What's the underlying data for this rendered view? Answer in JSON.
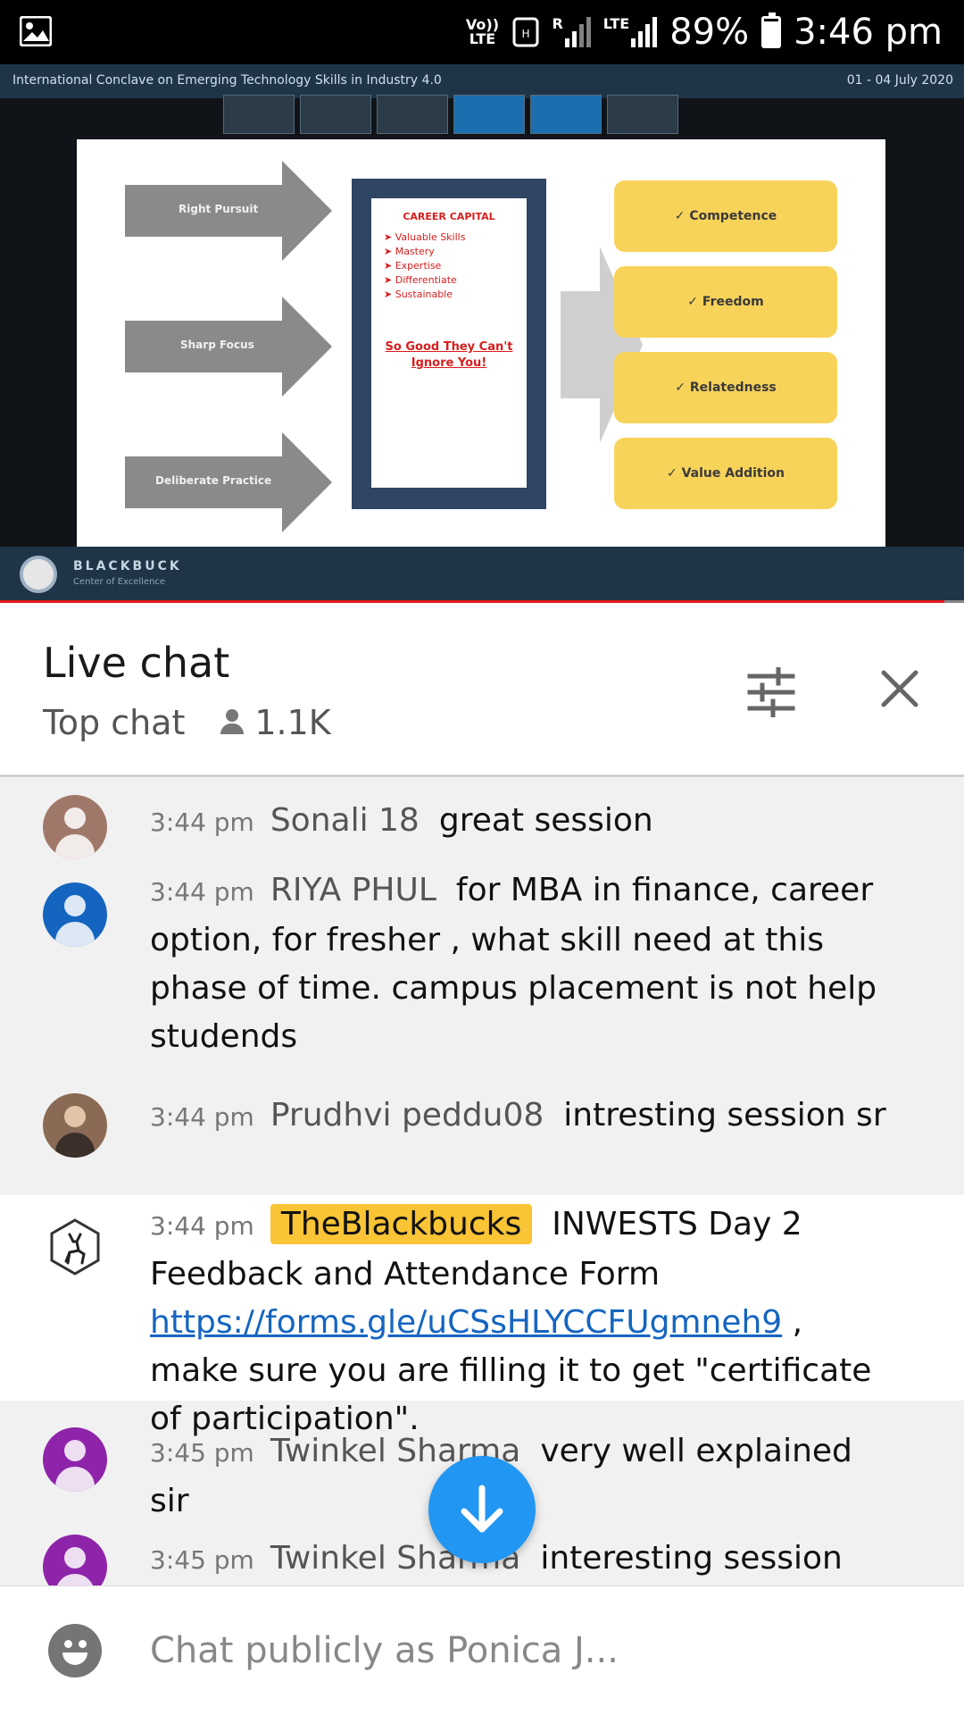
{
  "status_bar": {
    "volte": "Vo)) LTE",
    "roaming": "R",
    "network": "LTE",
    "battery": "89%",
    "battery_level": 0.89,
    "time": "3:46 pm"
  },
  "video": {
    "banner_title": "International Conclave on Emerging Technology Skills in Industry 4.0",
    "banner_date": "01 - 04 July 2020",
    "slide": {
      "arrows": [
        "Right Pursuit",
        "Sharp Focus",
        "Deliberate Practice"
      ],
      "career_capital_title": "CAREER CAPITAL",
      "career_capital_items": [
        "Valuable Skills",
        "Mastery",
        "Expertise",
        "Differentiate",
        "Sustainable"
      ],
      "quote": "So Good They Can't Ignore You!",
      "outcomes": [
        "✓ Competence",
        "✓ Freedom",
        "✓ Relatedness",
        "✓ Value Addition"
      ]
    },
    "footer_brand": "BLACKBUCK",
    "footer_brand_sub": "Center of Excellence",
    "progress": 0.98
  },
  "chat_header": {
    "title": "Live chat",
    "mode": "Top chat",
    "viewers": "1.1K"
  },
  "messages": [
    {
      "time": "3:44 pm",
      "author": "Sonali 18",
      "text": "great session",
      "avatar_color": "#a0786a"
    },
    {
      "time": "3:44 pm",
      "author": "RIYA PHUL",
      "text": "for MBA in finance, career option, for fresher , what skill need at this phase of time. campus placement is not help studends",
      "avatar_color": "#1565c0"
    },
    {
      "time": "3:44 pm",
      "author": "Prudhvi peddu08",
      "text": "intresting session sr",
      "avatar_color": "#8a6a55"
    },
    {
      "time": "3:44 pm",
      "author": "TheBlackbucks",
      "text_before": "INWESTS Day 2 Feedback and Attendance Form",
      "link": "https://forms.gle/uCSsHLYCCFUgmneh9",
      "text_after": ", make sure you are filling it to get \"certificate of participation\".",
      "avatar_color": "#ffffff"
    },
    {
      "time": "3:45 pm",
      "author": "Twinkel Sharma",
      "text": "very well explained sir",
      "avatar_color": "#8e24aa"
    },
    {
      "time": "3:45 pm",
      "author": "Twinkel Sharma",
      "text": "interesting session",
      "avatar_color": "#8e24aa"
    }
  ],
  "input": {
    "placeholder": "Chat publicly as Ponica J..."
  },
  "icons": {
    "filter": "tune-icon",
    "close": "close-icon",
    "scroll": "arrow-down-icon",
    "emoji": "emoji-icon"
  }
}
